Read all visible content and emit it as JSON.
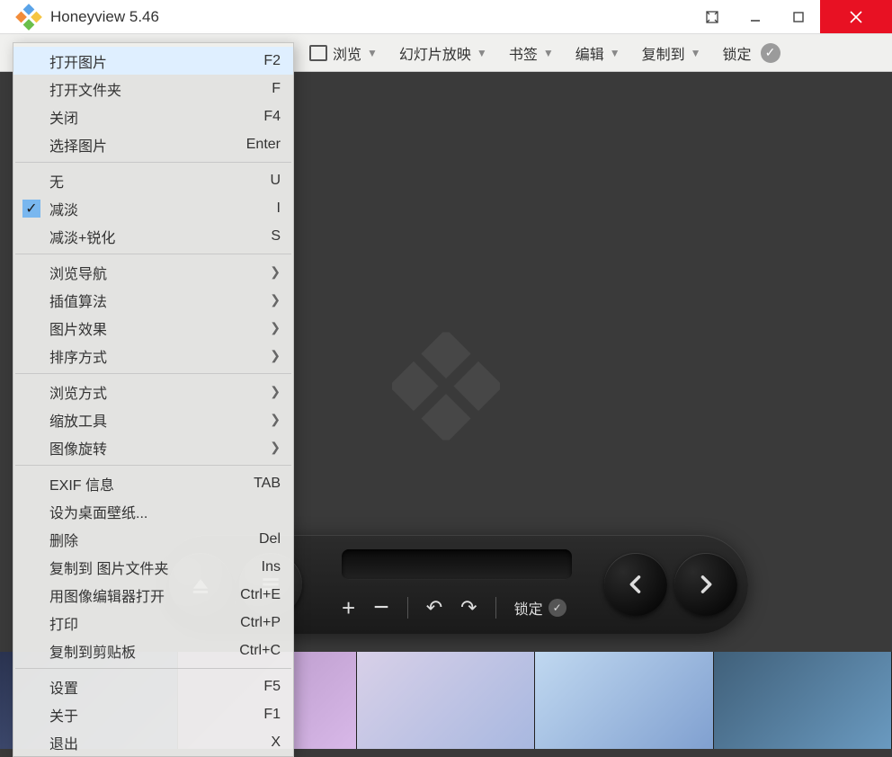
{
  "title": "Honeyview 5.46",
  "toolbar": {
    "browse": "浏览",
    "slideshow": "幻灯片放映",
    "bookmark": "书签",
    "edit": "编辑",
    "copyto": "复制到",
    "lock": "锁定"
  },
  "overlay": {
    "lock": "锁定"
  },
  "menu": {
    "groups": [
      [
        {
          "label": "打开图片",
          "shortcut": "F2",
          "hover": true
        },
        {
          "label": "打开文件夹",
          "shortcut": "F"
        },
        {
          "label": "关闭",
          "shortcut": "F4"
        },
        {
          "label": "选择图片",
          "shortcut": "Enter"
        }
      ],
      [
        {
          "label": "无",
          "shortcut": "U"
        },
        {
          "label": "减淡",
          "shortcut": "I",
          "checked": true
        },
        {
          "label": "减淡+锐化",
          "shortcut": "S"
        }
      ],
      [
        {
          "label": "浏览导航",
          "submenu": true
        },
        {
          "label": "插值算法",
          "submenu": true
        },
        {
          "label": "图片效果",
          "submenu": true
        },
        {
          "label": "排序方式",
          "submenu": true
        }
      ],
      [
        {
          "label": "浏览方式",
          "submenu": true
        },
        {
          "label": "缩放工具",
          "submenu": true
        },
        {
          "label": "图像旋转",
          "submenu": true
        }
      ],
      [
        {
          "label": "EXIF 信息",
          "shortcut": "TAB"
        },
        {
          "label": "设为桌面壁纸..."
        },
        {
          "label": "删除",
          "shortcut": "Del"
        },
        {
          "label": "复制到 图片文件夹",
          "shortcut": "Ins"
        },
        {
          "label": "用图像编辑器打开",
          "shortcut": "Ctrl+E"
        },
        {
          "label": "打印",
          "shortcut": "Ctrl+P"
        },
        {
          "label": "复制到剪贴板",
          "shortcut": "Ctrl+C"
        }
      ],
      [
        {
          "label": "设置",
          "shortcut": "F5"
        },
        {
          "label": "关于",
          "shortcut": "F1"
        },
        {
          "label": "退出",
          "shortcut": "X"
        }
      ]
    ]
  }
}
